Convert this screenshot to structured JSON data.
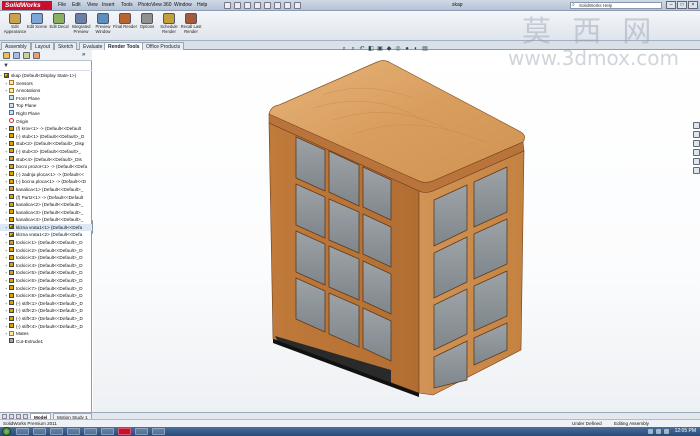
{
  "app": {
    "logo": "SolidWorks",
    "menu": [
      "File",
      "Edit",
      "View",
      "Insert",
      "Tools",
      "PhotoView 360",
      "Window",
      "Help"
    ],
    "document_title": "skap",
    "search_placeholder": "SolidWorks Help"
  },
  "toolbar": {
    "items": [
      {
        "label": "Edit Appearance",
        "icon": "appearance-icon",
        "color": "#c9a24b"
      },
      {
        "label": "Edit Scene",
        "icon": "scene-icon",
        "color": "#7aa7d8"
      },
      {
        "label": "Edit Decal",
        "icon": "decal-icon",
        "color": "#8bb060"
      },
      {
        "label": "Integrated Preview",
        "icon": "preview-icon",
        "color": "#6c7fa8"
      },
      {
        "label": "Preview Window",
        "icon": "preview-window-icon",
        "color": "#5b8fc2"
      },
      {
        "label": "Final Render",
        "icon": "render-icon",
        "color": "#b8652d"
      },
      {
        "label": "Options",
        "icon": "options-icon",
        "color": "#909090"
      },
      {
        "label": "Schedule Render",
        "icon": "schedule-icon",
        "color": "#c4a03c"
      },
      {
        "label": "Recall Last Render",
        "icon": "recall-icon",
        "color": "#a35a3a"
      }
    ]
  },
  "tabs": [
    {
      "label": "Assembly",
      "active": false
    },
    {
      "label": "Layout",
      "active": false
    },
    {
      "label": "Sketch",
      "active": false
    },
    {
      "label": "Evaluate",
      "active": false
    },
    {
      "label": "Render Tools",
      "active": true
    },
    {
      "label": "Office Products",
      "active": false
    }
  ],
  "tree": {
    "root": "skap  (Default<Display State-1>)",
    "items": [
      {
        "label": "Sensors",
        "icon": "folder"
      },
      {
        "label": "Annotations",
        "icon": "folder"
      },
      {
        "label": "Front Plane",
        "icon": "plane"
      },
      {
        "label": "Top Plane",
        "icon": "plane"
      },
      {
        "label": "Right Plane",
        "icon": "plane"
      },
      {
        "label": "Origin",
        "icon": "origin"
      },
      {
        "label": "(f) krov<1> -> (Default<<Default",
        "icon": "part"
      },
      {
        "label": "(-) stub<1> (Default<<Default>_D",
        "icon": "part"
      },
      {
        "label": "stub<2> (Default<<Default>_Disp",
        "icon": "part"
      },
      {
        "label": "(-) stub<3> (Default<<Default>_",
        "icon": "part"
      },
      {
        "label": "stub<4> (Default<<Default>_Dis",
        "icon": "part"
      },
      {
        "label": "bocni prozor<1> -> (Default<<Defa",
        "icon": "part"
      },
      {
        "label": "(-) zadnja ploca<1> -> (Default<<",
        "icon": "part"
      },
      {
        "label": "(-) bocna ploca<1> -> (Default<<D",
        "icon": "part"
      },
      {
        "label": "kanalica<1> (Default<<Default>_",
        "icon": "part"
      },
      {
        "label": "(f) Part2<1> -> (Default<<Default",
        "icon": "part"
      },
      {
        "label": "kanalica<2> (Default<<Default>_",
        "icon": "part"
      },
      {
        "label": "kanalica<3> (Default<<Default>_",
        "icon": "part"
      },
      {
        "label": "kanalica<4> (Default<<Default>_",
        "icon": "part"
      },
      {
        "label": "klizna vrata1<1> (Default<<Defa",
        "icon": "asm",
        "selected": true
      },
      {
        "label": "klizna vrata1<2> (Default<<Defa",
        "icon": "asm"
      },
      {
        "label": "tockici<1> (Default<<Default>_D",
        "icon": "part"
      },
      {
        "label": "tockici<2> (Default<<Default>_D",
        "icon": "part"
      },
      {
        "label": "tockici<3> (Default<<Default>_D",
        "icon": "part"
      },
      {
        "label": "tockici<4> (Default<<Default>_D",
        "icon": "part"
      },
      {
        "label": "tockici<5> (Default<<Default>_D",
        "icon": "part"
      },
      {
        "label": "tockici<6> (Default<<Default>_D",
        "icon": "part"
      },
      {
        "label": "tockici<7> (Default<<Default>_D",
        "icon": "part"
      },
      {
        "label": "tockici<8> (Default<<Default>_D",
        "icon": "part"
      },
      {
        "label": "(-) stift<1> (Default<<Default>_D",
        "icon": "part"
      },
      {
        "label": "(-) stift<2> (Default<<Default>_D",
        "icon": "part"
      },
      {
        "label": "(-) stift<3> (Default<<Default>_D",
        "icon": "part"
      },
      {
        "label": "(-) stift<4> (Default<<Default>_D",
        "icon": "part"
      },
      {
        "label": "Mates",
        "icon": "folder"
      },
      {
        "label": "Cut-Extrude1",
        "icon": "cut"
      }
    ]
  },
  "watermark": {
    "line1": "莫 西 网",
    "line2": "www.3dmox.com"
  },
  "bottom_tabs": [
    {
      "label": "Model",
      "active": true
    },
    {
      "label": "Motion Study 1",
      "active": false
    }
  ],
  "status": {
    "product": "SolidWorks Premium 2011",
    "state": "Under Defined",
    "mode": "Editing Assembly",
    "clock": "12:05 PM"
  },
  "colors": {
    "wood": "#d8a566",
    "wood_dark": "#9a5a2a",
    "glass": "#8f9498",
    "accent_red": "#c8102e"
  }
}
